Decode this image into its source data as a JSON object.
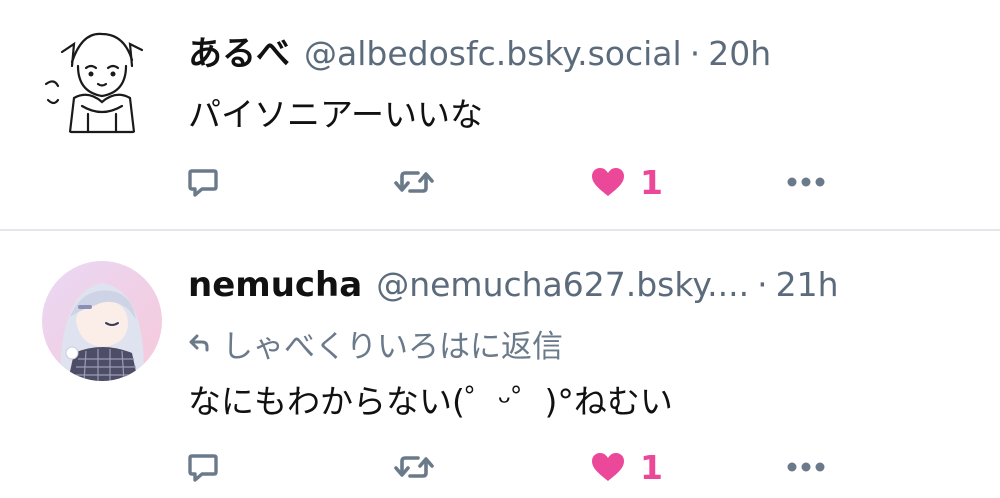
{
  "colors": {
    "accent_like": "#ec4899",
    "muted": "#5b6b7c",
    "icon": "#6b7a8a",
    "divider": "#e3e6ea"
  },
  "posts": [
    {
      "display_name": "あるべ",
      "handle": "@albedosfc.bsky.social",
      "separator": "·",
      "time": "20h",
      "text": "パイソニアーいいな",
      "avatar_icon": "avatar-sketch-girl",
      "like_count": "1",
      "liked": true
    },
    {
      "display_name": "nemucha",
      "handle": "@nemucha627.bsky....",
      "separator": "·",
      "time": "21h",
      "reply_to": "しゃべくりいろはに返信",
      "text": "なにもわからない(゜ᵕ゜)°ねむい",
      "avatar_icon": "avatar-sleepy-girl",
      "like_count": "1",
      "liked": true
    }
  ],
  "icons": {
    "reply": "comment-bubble-icon",
    "repost": "repost-arrows-icon",
    "like": "heart-icon",
    "more": "more-dots-icon",
    "reply_arrow": "reply-arrow-icon"
  }
}
